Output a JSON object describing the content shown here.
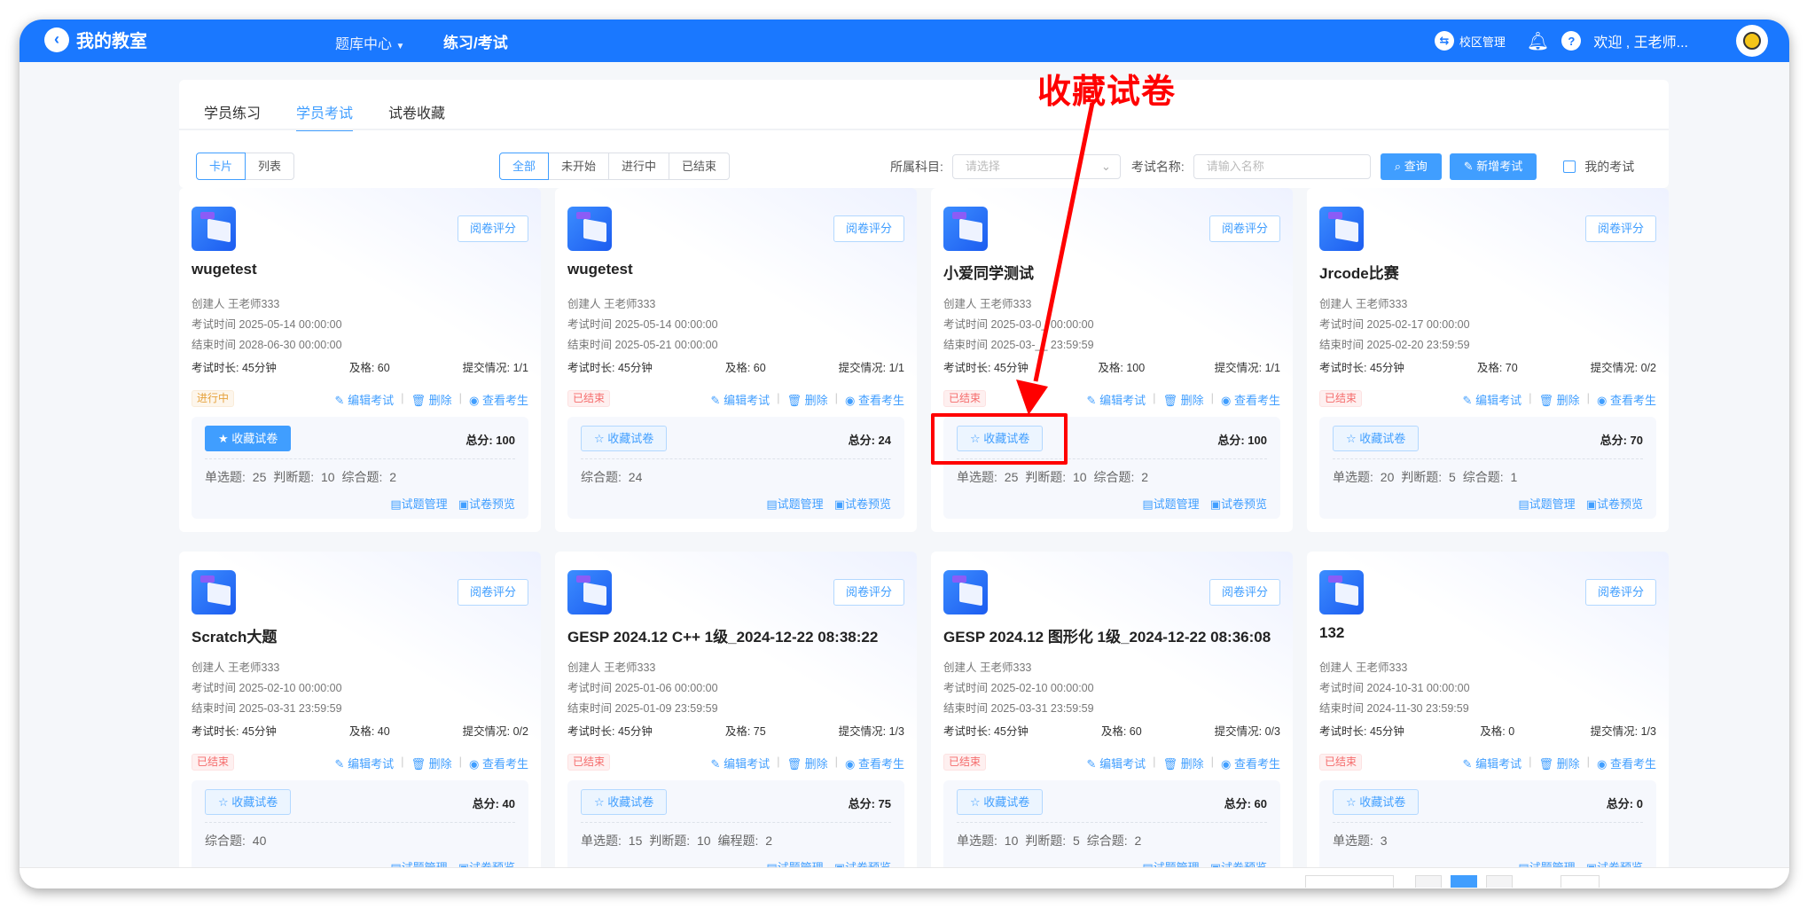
{
  "header": {
    "brand": "我的教室",
    "nav": [
      "题库中心",
      "练习/考试"
    ],
    "campus": "校区管理",
    "welcome": "欢迎 , 王老师..."
  },
  "tabs": [
    "学员练习",
    "学员考试",
    "试卷收藏"
  ],
  "view_modes": [
    "卡片",
    "列表"
  ],
  "status_filters": [
    "全部",
    "未开始",
    "进行中",
    "已结束"
  ],
  "filters": {
    "subject_label": "所属科目:",
    "subject_placeholder": "请选择",
    "name_label": "考试名称:",
    "name_placeholder": "请输入名称",
    "search": "查询",
    "add": "新增考试",
    "mine": "我的考试"
  },
  "labels": {
    "grade": "阅卷评分",
    "creator": "创建人",
    "start": "考试时间",
    "end": "结束时间",
    "duration": "考试时长:",
    "pass": "及格:",
    "submit": "提交情况:",
    "edit": "编辑考试",
    "delete": "删除",
    "view": "查看考生",
    "fav": "收藏试卷",
    "total": "总分:",
    "manage": "试题管理",
    "preview": "试卷预览"
  },
  "annotation": "收藏试卷",
  "cards": [
    {
      "title": "wugetest",
      "creator": "王老师333",
      "start": "2025-05-14 00:00:00",
      "end": "2028-06-30 00:00:00",
      "duration": "45分钟",
      "pass": "60",
      "submit": "1/1",
      "status": "进行中",
      "status_type": "run",
      "fav": true,
      "total": "100",
      "counts": "单选题: 25   判断题: 10   综合题: 2"
    },
    {
      "title": "wugetest",
      "creator": "王老师333",
      "start": "2025-05-14 00:00:00",
      "end": "2025-05-21 00:00:00",
      "duration": "45分钟",
      "pass": "60",
      "submit": "1/1",
      "status": "已结束",
      "status_type": "end",
      "fav": false,
      "total": "24",
      "counts": "综合题: 24"
    },
    {
      "title": "小爱同学测试",
      "creator": "王老师333",
      "start": "2025-03-0_ 00:00:00",
      "end": "2025-03-__ 23:59:59",
      "duration": "45分钟",
      "pass": "100",
      "submit": "1/1",
      "status": "已结束",
      "status_type": "end",
      "fav": false,
      "total": "100",
      "counts": "单选题: 25   判断题: 10   综合题: 2"
    },
    {
      "title": "Jrcode比赛",
      "creator": "王老师333",
      "start": "2025-02-17 00:00:00",
      "end": "2025-02-20 23:59:59",
      "duration": "45分钟",
      "pass": "70",
      "submit": "0/2",
      "status": "已结束",
      "status_type": "end",
      "fav": false,
      "total": "70",
      "counts": "单选题: 20   判断题: 5   综合题: 1"
    },
    {
      "title": "Scratch大题",
      "creator": "王老师333",
      "start": "2025-02-10 00:00:00",
      "end": "2025-03-31 23:59:59",
      "duration": "45分钟",
      "pass": "40",
      "submit": "0/2",
      "status": "已结束",
      "status_type": "end",
      "fav": false,
      "total": "40",
      "counts": "综合题: 40"
    },
    {
      "title": "GESP 2024.12 C++ 1级_2024-12-22 08:38:22",
      "creator": "王老师333",
      "start": "2025-01-06 00:00:00",
      "end": "2025-01-09 23:59:59",
      "duration": "45分钟",
      "pass": "75",
      "submit": "1/3",
      "status": "已结束",
      "status_type": "end",
      "fav": false,
      "total": "75",
      "counts": "单选题: 15   判断题: 10   编程题: 2"
    },
    {
      "title": "GESP 2024.12 图形化 1级_2024-12-22 08:36:08",
      "creator": "王老师333",
      "start": "2025-02-10 00:00:00",
      "end": "2025-03-31 23:59:59",
      "duration": "45分钟",
      "pass": "60",
      "submit": "0/3",
      "status": "已结束",
      "status_type": "end",
      "fav": false,
      "total": "60",
      "counts": "单选题: 10   判断题: 5   综合题: 2"
    },
    {
      "title": "132",
      "creator": "王老师333",
      "start": "2024-10-31 00:00:00",
      "end": "2024-11-30 23:59:59",
      "duration": "45分钟",
      "pass": "0",
      "submit": "1/3",
      "status": "已结束",
      "status_type": "end",
      "fav": false,
      "total": "0",
      "counts": "单选题: 3"
    }
  ]
}
